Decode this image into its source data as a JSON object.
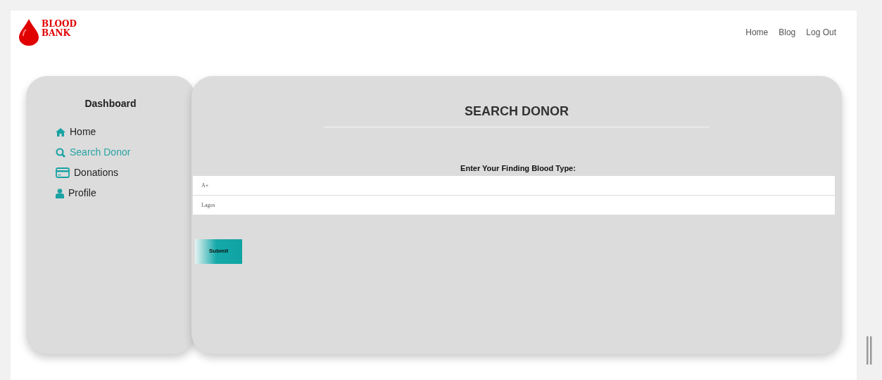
{
  "logo": {
    "line_1": "BLOOD",
    "line_2": "BANK"
  },
  "nav": [
    "Home",
    "Blog",
    "Log Out"
  ],
  "sidebar": {
    "title": "Dashboard",
    "items": [
      {
        "label": "Home",
        "kind": "home",
        "selected": false
      },
      {
        "label": "Search Donor",
        "kind": "search",
        "selected": true
      },
      {
        "label": "Donations",
        "kind": "card",
        "selected": false
      },
      {
        "label": "Profile",
        "kind": "user",
        "selected": false
      }
    ]
  },
  "main": {
    "title": "SEARCH DONOR",
    "label": "Enter Your Finding Blood Type:",
    "fields": [
      {
        "value": "A+"
      },
      {
        "value": "Lagos"
      }
    ],
    "submit": "Submit"
  }
}
